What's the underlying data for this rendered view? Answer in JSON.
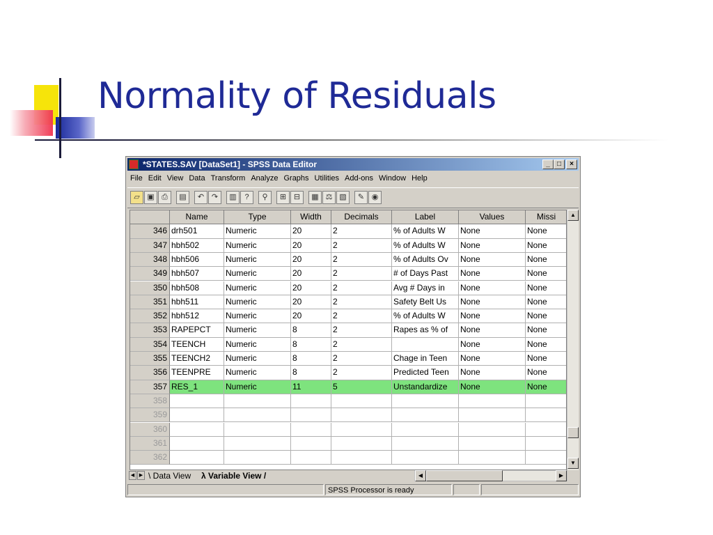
{
  "slide": {
    "title": "Normality of Residuals"
  },
  "window": {
    "title": "*STATES.SAV [DataSet1] - SPSS Data Editor",
    "controls": [
      "_",
      "□",
      "×"
    ]
  },
  "menu": [
    "File",
    "Edit",
    "View",
    "Data",
    "Transform",
    "Analyze",
    "Graphs",
    "Utilities",
    "Add-ons",
    "Window",
    "Help"
  ],
  "toolbar_icons": [
    "open-folder-icon",
    "save-icon",
    "print-icon",
    "dialog-recall-icon",
    "undo-icon",
    "redo-icon",
    "goto-case-icon",
    "variables-icon",
    "find-icon",
    "insert-case-icon",
    "insert-variable-icon",
    "split-file-icon",
    "weight-cases-icon",
    "select-cases-icon",
    "value-labels-icon",
    "use-sets-icon"
  ],
  "grid": {
    "columns": [
      "Name",
      "Type",
      "Width",
      "Decimals",
      "Label",
      "Values",
      "Missi"
    ],
    "rows": [
      {
        "num": "346",
        "cells": [
          "drh501",
          "Numeric",
          "20",
          "2",
          "% of Adults W",
          "None",
          "None"
        ]
      },
      {
        "num": "347",
        "cells": [
          "hbh502",
          "Numeric",
          "20",
          "2",
          "% of Adults W",
          "None",
          "None"
        ]
      },
      {
        "num": "348",
        "cells": [
          "hbh506",
          "Numeric",
          "20",
          "2",
          "% of Adults Ov",
          "None",
          "None"
        ]
      },
      {
        "num": "349",
        "cells": [
          "hbh507",
          "Numeric",
          "20",
          "2",
          "# of Days Past",
          "None",
          "None"
        ]
      },
      {
        "num": "350",
        "cells": [
          "hbh508",
          "Numeric",
          "20",
          "2",
          "Avg # Days in",
          "None",
          "None"
        ]
      },
      {
        "num": "351",
        "cells": [
          "hbh511",
          "Numeric",
          "20",
          "2",
          "Safety Belt Us",
          "None",
          "None"
        ]
      },
      {
        "num": "352",
        "cells": [
          "hbh512",
          "Numeric",
          "20",
          "2",
          "% of Adults W",
          "None",
          "None"
        ]
      },
      {
        "num": "353",
        "cells": [
          "RAPEPCT",
          "Numeric",
          "8",
          "2",
          "Rapes as % of",
          "None",
          "None"
        ]
      },
      {
        "num": "354",
        "cells": [
          "TEENCH",
          "Numeric",
          "8",
          "2",
          "",
          "None",
          "None"
        ]
      },
      {
        "num": "355",
        "cells": [
          "TEENCH2",
          "Numeric",
          "8",
          "2",
          "Chage in Teen",
          "None",
          "None"
        ]
      },
      {
        "num": "356",
        "cells": [
          "TEENPRE",
          "Numeric",
          "8",
          "2",
          "Predicted Teen",
          "None",
          "None"
        ]
      },
      {
        "num": "357",
        "cells": [
          "RES_1",
          "Numeric",
          "11",
          "5",
          "Unstandardize",
          "None",
          "None"
        ],
        "selected": true
      },
      {
        "num": "358",
        "cells": [
          "",
          "",
          "",
          "",
          "",
          "",
          ""
        ],
        "empty": true
      },
      {
        "num": "359",
        "cells": [
          "",
          "",
          "",
          "",
          "",
          "",
          ""
        ],
        "empty": true
      },
      {
        "num": "360",
        "cells": [
          "",
          "",
          "",
          "",
          "",
          "",
          ""
        ],
        "empty": true
      },
      {
        "num": "361",
        "cells": [
          "",
          "",
          "",
          "",
          "",
          "",
          ""
        ],
        "empty": true
      },
      {
        "num": "362",
        "cells": [
          "",
          "",
          "",
          "",
          "",
          "",
          ""
        ],
        "empty": true
      }
    ]
  },
  "tabs": {
    "data_view": "Data View",
    "variable_view": "Variable View",
    "active": "Variable View"
  },
  "status": {
    "processor": "SPSS Processor is ready"
  },
  "colors": {
    "title": "#1f2a96",
    "selected_row": "#7ee37e",
    "titlebar_start": "#0a246a",
    "titlebar_end": "#a6caf0"
  }
}
